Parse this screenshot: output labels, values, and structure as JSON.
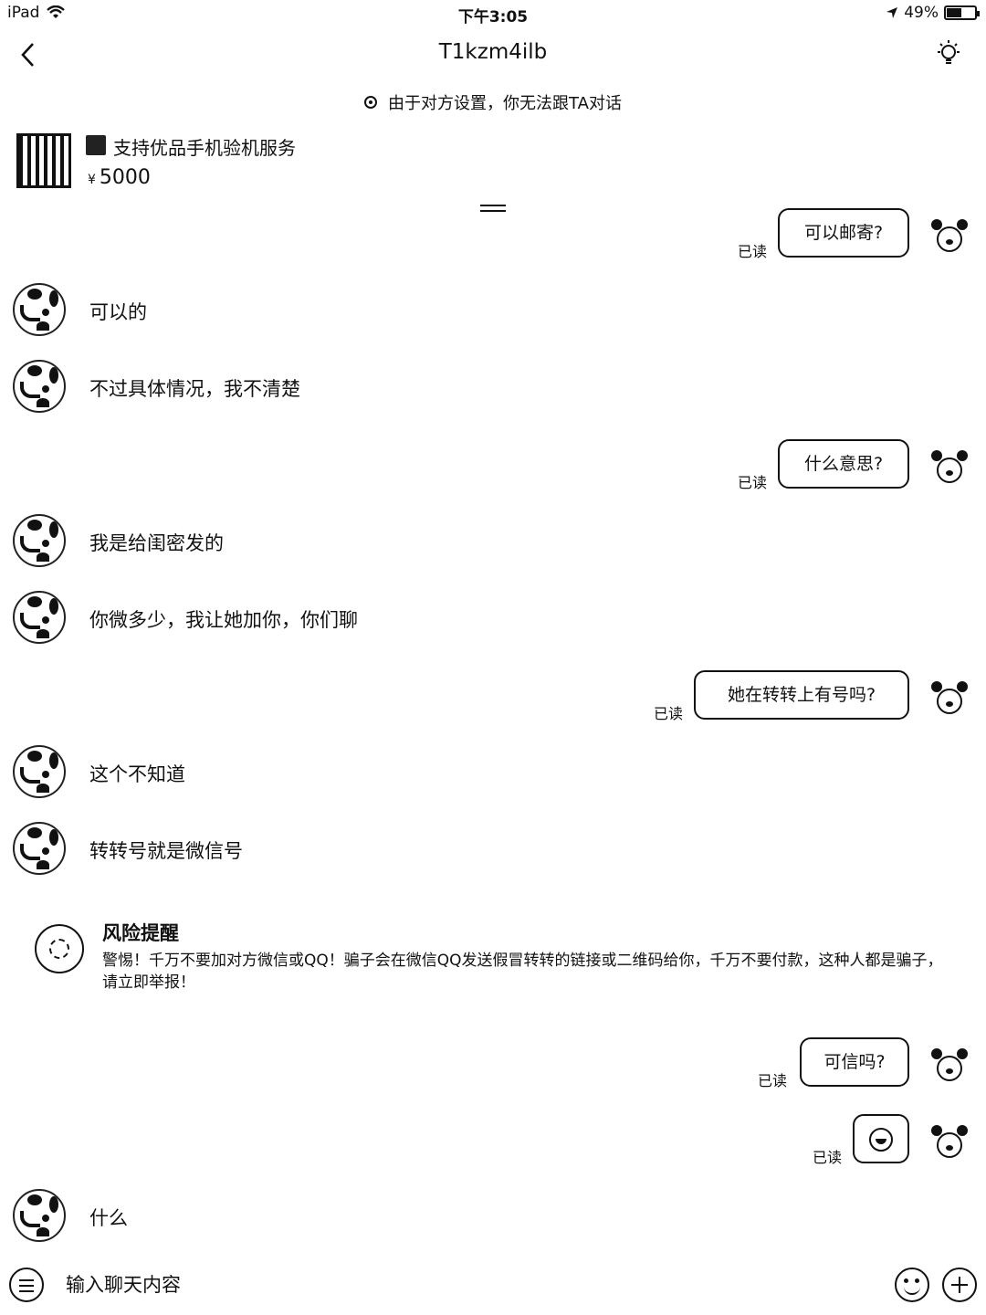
{
  "status_bar": {
    "device": "iPad",
    "time": "下午3:05",
    "battery": "49%",
    "battery_level": 0.49
  },
  "nav": {
    "title": "T1kzm4ilb"
  },
  "notice": "由于对方设置，你无法跟TA对话",
  "product": {
    "title": "支持优品手机验机服务",
    "currency": "¥",
    "price": "5000"
  },
  "read_label": "已读",
  "messages": [
    {
      "dir": "out",
      "text": "可以邮寄?"
    },
    {
      "dir": "in",
      "text": "可以的"
    },
    {
      "dir": "in",
      "text": "不过具体情况，我不清楚"
    },
    {
      "dir": "out",
      "text": "什么意思?"
    },
    {
      "dir": "in",
      "text": "我是给闺密发的"
    },
    {
      "dir": "in",
      "text": "你微多少，我让她加你，你们聊"
    },
    {
      "dir": "out",
      "text": "她在转转上有号吗?"
    },
    {
      "dir": "in",
      "text": "这个不知道"
    },
    {
      "dir": "in",
      "text": "转转号就是微信号"
    },
    {
      "dir": "out",
      "text": "可信吗?"
    },
    {
      "dir": "out",
      "text": "",
      "emoji": "laugh-cry"
    },
    {
      "dir": "in",
      "text": "什么"
    }
  ],
  "risk": {
    "title": "风险提醒",
    "text": "警惕！千万不要加对方微信或QQ！骗子会在微信QQ发送假冒转转的链接或二维码给你，千万不要付款，这种人都是骗子，请立即举报！"
  },
  "input": {
    "placeholder": "输入聊天内容"
  },
  "icons": [
    "back-icon",
    "bulb-icon",
    "wifi-icon",
    "location-icon",
    "menu-icon",
    "emoji-icon",
    "plus-icon"
  ]
}
